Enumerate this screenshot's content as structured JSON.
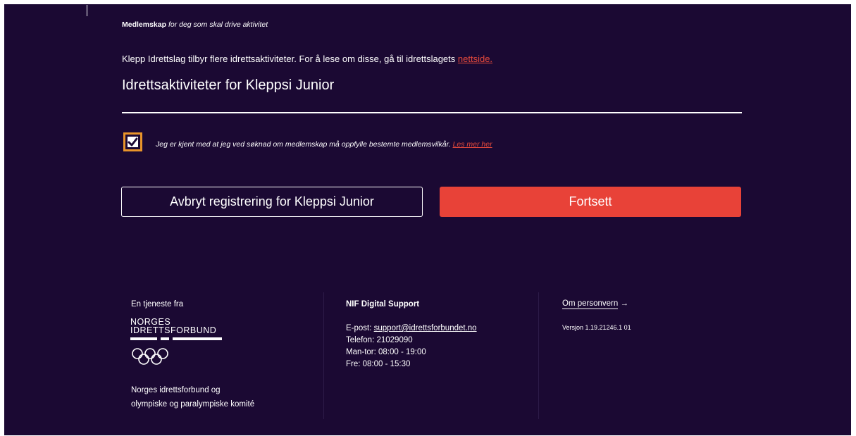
{
  "header": {
    "title": "Medlemskap",
    "subtitle": "for deg som skal drive aktivitet"
  },
  "intro": {
    "text": "Klepp Idrettslag tilbyr flere idrettsaktiviteter. For å lese om disse, gå til idrettslagets",
    "link": "nettside."
  },
  "section": {
    "title": "Idrettsaktiviteter for Kleppsi Junior"
  },
  "terms": {
    "checked": true,
    "text": "Jeg er kjent med at jeg ved søknad om medlemskap må oppfylle bestemte medlemsvilkår.",
    "link": "Les mer her"
  },
  "actions": {
    "cancel_label": "Avbryt registrering for Kleppsi Junior",
    "continue_label": "Fortsett"
  },
  "footer": {
    "service_label": "En tjeneste fra",
    "logo_line1": "NORGES",
    "logo_line2": "IDRETTSFORBUND",
    "org_line1": "Norges idrettsforbund og",
    "org_line2": "olympiske og paralympiske komité",
    "support_title": "NIF Digital Support",
    "email_label": "E-post:",
    "email": "support@idrettsforbundet.no",
    "phone": "Telefon: 21029090",
    "hours_weekday": "Man-tor: 08:00 - 19:00",
    "hours_friday": "Fre: 08:00 - 15:30",
    "privacy_link": "Om personvern",
    "version": "Versjon 1.19.21246.1 01"
  },
  "colors": {
    "background": "#1b0933",
    "accent": "#e84238",
    "checkbox_border": "#e8942a",
    "link": "#e84a3c"
  }
}
